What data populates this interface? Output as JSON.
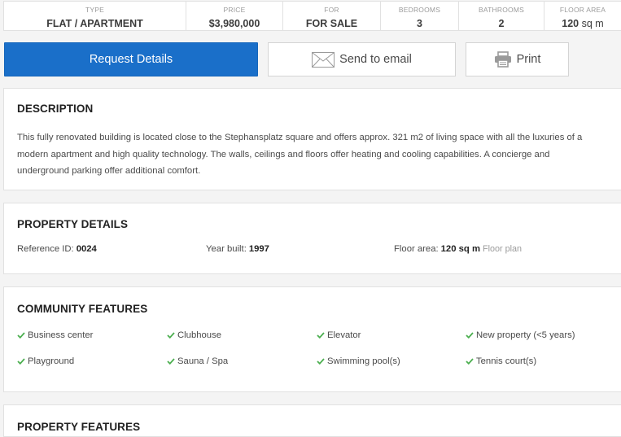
{
  "summary": {
    "type": {
      "label": "TYPE",
      "value": "FLAT / APARTMENT"
    },
    "price": {
      "label": "PRICE",
      "value": "$3,980,000"
    },
    "for": {
      "label": "FOR",
      "value": "FOR SALE"
    },
    "bedrooms": {
      "label": "BEDROOMS",
      "value": "3"
    },
    "bathrooms": {
      "label": "BATHROOMS",
      "value": "2"
    },
    "floor_area": {
      "label": "FLOOR AREA",
      "value": "120",
      "unit": "sq m"
    }
  },
  "actions": {
    "request": "Request Details",
    "email": "Send to email",
    "print": "Print"
  },
  "colors": {
    "primary": "#1a6fc9",
    "check": "#4caf50"
  },
  "description": {
    "title": "DESCRIPTION",
    "line1": "This fully renovated building is located close to the Stephansplatz square and offers approx. 321 m2 of living space with all the luxuries of a",
    "line2": "modern apartment and high quality technology. The walls, ceilings and floors offer heating and cooling capabilities. A concierge and",
    "line3": "underground parking offer additional comfort."
  },
  "details": {
    "title": "PROPERTY DETAILS",
    "reference": {
      "label": "Reference ID:",
      "value": "0024"
    },
    "year": {
      "label": "Year built:",
      "value": "1997"
    },
    "area": {
      "label": "Floor area:",
      "value": "120 sq m",
      "link": "Floor plan"
    }
  },
  "community": {
    "title": "COMMUNITY FEATURES",
    "items": [
      "Business center",
      "Clubhouse",
      "Elevator",
      "New property (<5 years)",
      "Playground",
      "Sauna / Spa",
      "Swimming pool(s)",
      "Tennis court(s)"
    ]
  },
  "property_features": {
    "title": "PROPERTY FEATURES"
  }
}
